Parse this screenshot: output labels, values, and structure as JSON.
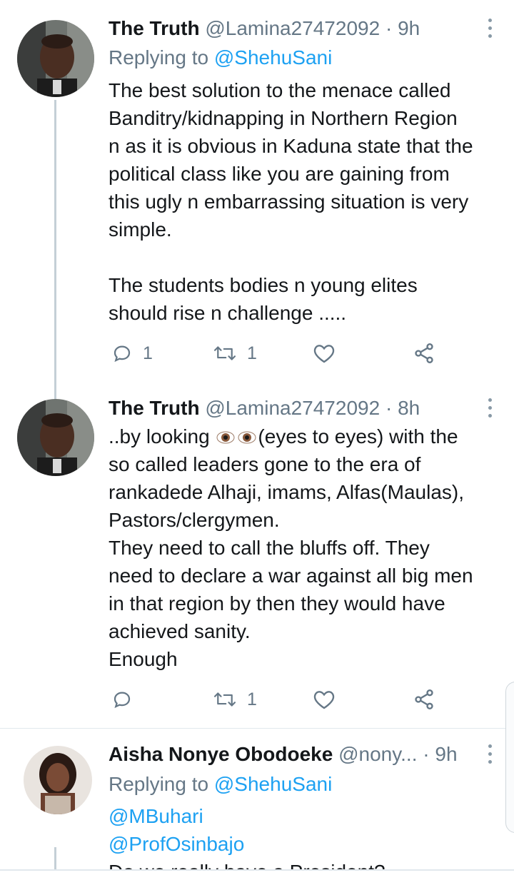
{
  "tweets": [
    {
      "name": "The Truth",
      "handle": "@Lamina27472092",
      "time": "9h",
      "replying_label": "Replying to",
      "replying_to": "@ShehuSani",
      "body_lines": [
        "The best solution to the menace called",
        "Banditry/kidnapping in Northern Region",
        "n as it is obvious in Kaduna state that the",
        "political class like you are gaining from",
        "this ugly n embarrassing situation is very",
        "simple.",
        "",
        "The students bodies n young elites",
        "should rise n challenge ....."
      ],
      "reply_count": "1",
      "retweet_count": "1",
      "like_count": ""
    },
    {
      "name": "The Truth",
      "handle": "@Lamina27472092",
      "time": "8h",
      "body_first_prefix": "..by looking ",
      "body_first_emoji": "👁👁",
      "body_first_suffix": "(eyes to eyes) with the",
      "body_lines": [
        "so called leaders gone to the era of",
        "rankadede Alhaji, imams, Alfas(Maulas),",
        "Pastors/clergymen.",
        "They need to call the bluffs off. They",
        "need to declare a war against all big men",
        "in that region by then they would have",
        "achieved sanity.",
        "Enough"
      ],
      "reply_count": "",
      "retweet_count": "1",
      "like_count": ""
    },
    {
      "name": "Aisha Nonye Obodoeke",
      "handle": "@nony...",
      "time": "9h",
      "replying_label": "Replying to",
      "replying_to": "@ShehuSani",
      "mentions": [
        "@MBuhari",
        "@ProfOsinbajo"
      ],
      "cut_line": "Do we really have a President?"
    }
  ],
  "icons": {
    "reply": "reply-bubble-icon",
    "retweet": "retweet-icon",
    "like": "heart-icon",
    "share": "share-icon",
    "more": "more-vertical-icon"
  },
  "colors": {
    "link": "#1da1f2",
    "secondary": "#657786",
    "text": "#14171a",
    "thread": "#c4cfd6"
  }
}
